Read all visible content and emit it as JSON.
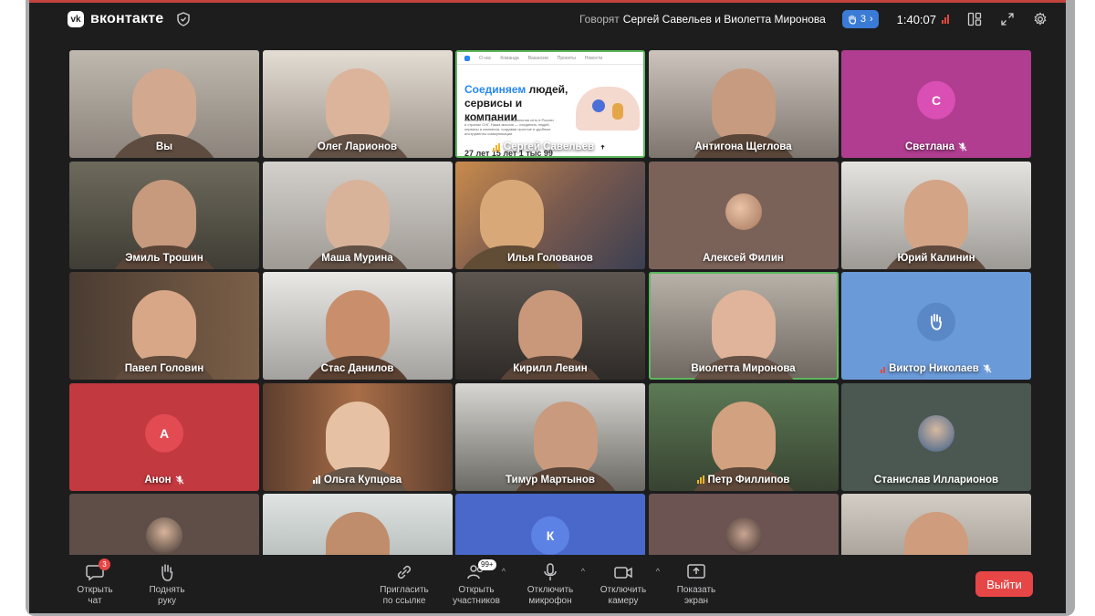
{
  "app": {
    "name": "вконтакте",
    "logo_text": "vk"
  },
  "header": {
    "speaking_prefix": "Говорят",
    "speaking_names": "Сергей Савельев и Виолетта Миронова",
    "raised_hands": "3",
    "timer": "1:40:07"
  },
  "shared_screen": {
    "nav_items": [
      "О нас",
      "Команда",
      "Вакансии",
      "Проекты",
      "Новости"
    ],
    "headline_accent": "Соединяем",
    "headline_rest": "людей, сервисы и компании",
    "paragraph": "ВКонтакте — крупнейшая социальная сеть в России и странах СНГ. Наша миссия — соединять людей, сервисы и компании, создавая простые и удобные инструменты коммуникации.",
    "bottom_cut": "27 лет  15 лет  1 тыс  99"
  },
  "participants": [
    {
      "name": "Вы"
    },
    {
      "name": "Олег Ларионов"
    },
    {
      "name": "Сергей Савельев",
      "speaking": true,
      "presenting": true
    },
    {
      "name": "Антигона Щеглова"
    },
    {
      "name": "Светлана",
      "initial": "С",
      "muted": true
    },
    {
      "name": "Эмиль Трошин"
    },
    {
      "name": "Маша Мурина"
    },
    {
      "name": "Илья Голованов"
    },
    {
      "name": "Алексей Филин"
    },
    {
      "name": "Юрий Калинин"
    },
    {
      "name": "Павел Головин"
    },
    {
      "name": "Стас Данилов"
    },
    {
      "name": "Кирилл Левин"
    },
    {
      "name": "Виолетта Миронова",
      "speaking": true
    },
    {
      "name": "Виктор Николаев",
      "muted": true,
      "hand_raised": true
    },
    {
      "name": "Анон",
      "initial": "А",
      "muted": true
    },
    {
      "name": "Ольга Купцова",
      "speaking": true
    },
    {
      "name": "Тимур Мартынов"
    },
    {
      "name": "Петр Филлипов",
      "speaking": true
    },
    {
      "name": "Станислав Илларионов"
    },
    {
      "name": ""
    },
    {
      "name": ""
    },
    {
      "name": "",
      "initial": "К"
    },
    {
      "name": ""
    },
    {
      "name": ""
    }
  ],
  "controls": {
    "open_chat": "Открыть чат",
    "chat_badge": "3",
    "raise_hand": "Поднять руку",
    "invite": "Пригласить по ссылке",
    "participants": "Открыть участников",
    "participants_badge": "99+",
    "mic": "Отключить микрофон",
    "camera": "Отключить камеру",
    "screen": "Показать экран",
    "leave": "Выйти"
  },
  "colors": {
    "accent_blue": "#3a7bd5",
    "leave_red": "#e64646",
    "speaking_green": "#5db85c",
    "svetlana_tile": "#b03d90",
    "anon_tile": "#c2393f",
    "viktor_tile": "#6b9ad8",
    "k_tile": "#4968c9"
  }
}
